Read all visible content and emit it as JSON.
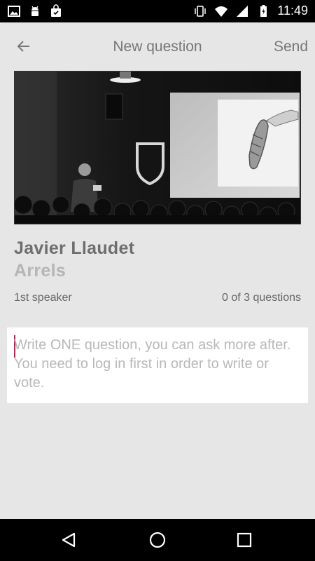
{
  "status_bar": {
    "time": "11:49",
    "left_icons": [
      "image-icon",
      "android-icon",
      "shopping-bag-icon"
    ],
    "right_icons": [
      "vibrate-icon",
      "wifi-icon",
      "signal-icon",
      "battery-icon"
    ]
  },
  "app_bar": {
    "title": "New question",
    "send_label": "Send",
    "back_icon": "arrow-left-icon"
  },
  "speaker": {
    "name": "Javier Llaudet",
    "organization": "Arrels",
    "position_label": "1st speaker",
    "questions_count": "0 of 3 questions"
  },
  "question": {
    "value": "",
    "placeholder": "Write ONE question, you can ask more after. You need to log in first in order to write or vote."
  },
  "nav_bar": {
    "icons": [
      "back-triangle-icon",
      "home-circle-icon",
      "recents-square-icon"
    ]
  },
  "colors": {
    "background": "#e6e6e6",
    "cursor": "#d4145a",
    "text_primary": "#6e6e6e",
    "text_secondary": "#b5b5b5"
  }
}
